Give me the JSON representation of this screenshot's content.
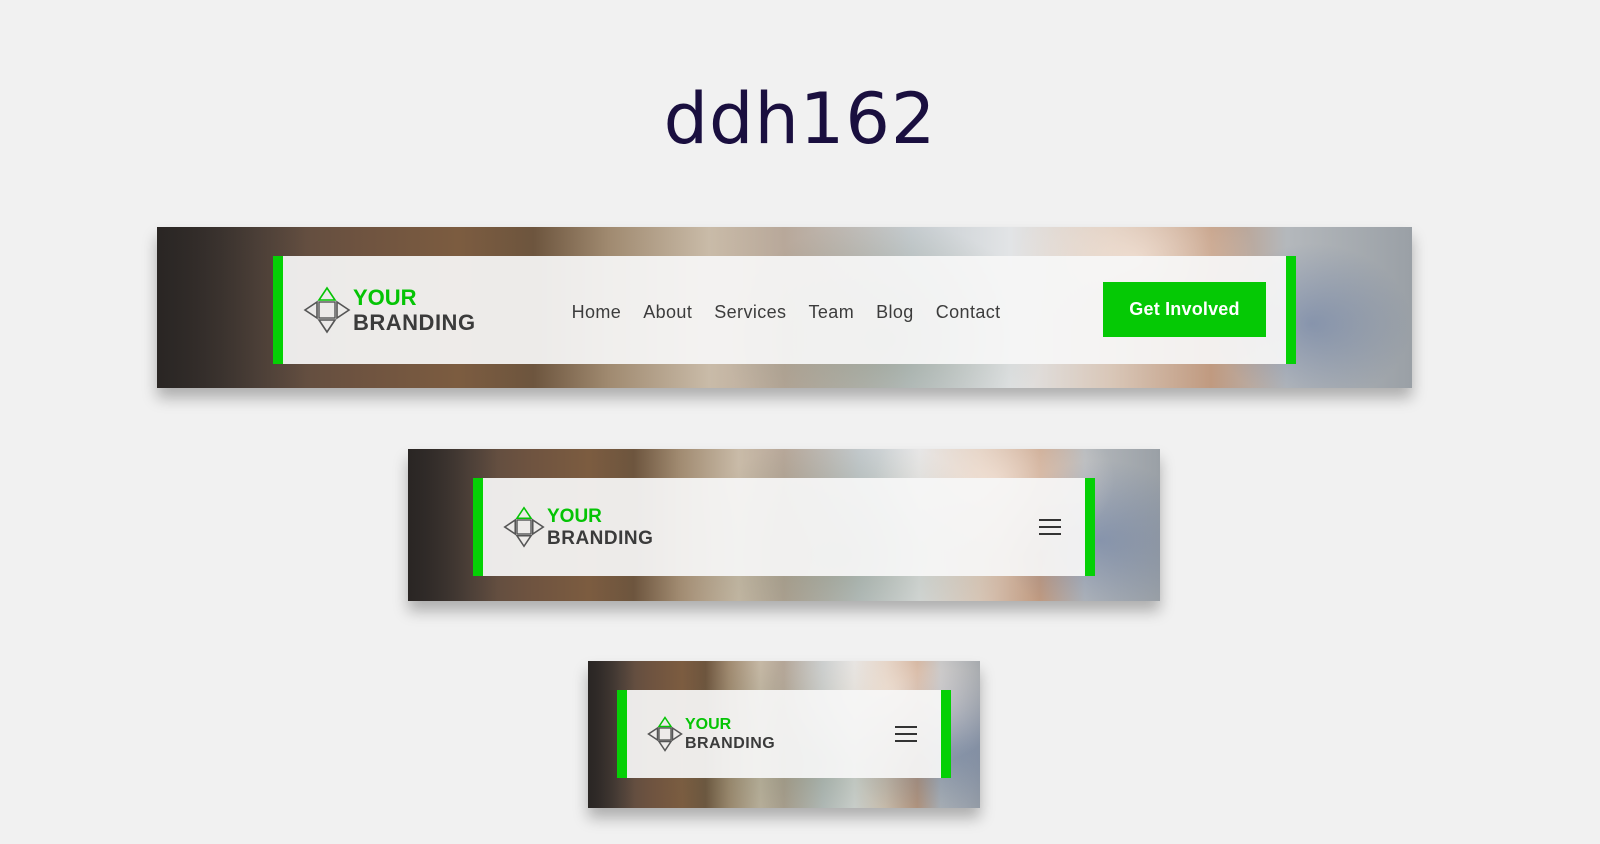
{
  "page_title": "ddh162",
  "colors": {
    "accent": "#05d005",
    "title": "#1a0f3f",
    "text": "#3c3c3c",
    "background": "#f1f1f1"
  },
  "brand": {
    "line1": "YOUR",
    "line2": "BRANDING",
    "icon": "diamond-arrows-logo-icon"
  },
  "desktop_nav": {
    "links": [
      "Home",
      "About",
      "Services",
      "Team",
      "Blog",
      "Contact"
    ],
    "cta_label": "Get Involved"
  },
  "tablet_nav": {
    "menu_icon": "hamburger-menu-icon"
  },
  "mobile_nav": {
    "menu_icon": "hamburger-menu-icon"
  }
}
